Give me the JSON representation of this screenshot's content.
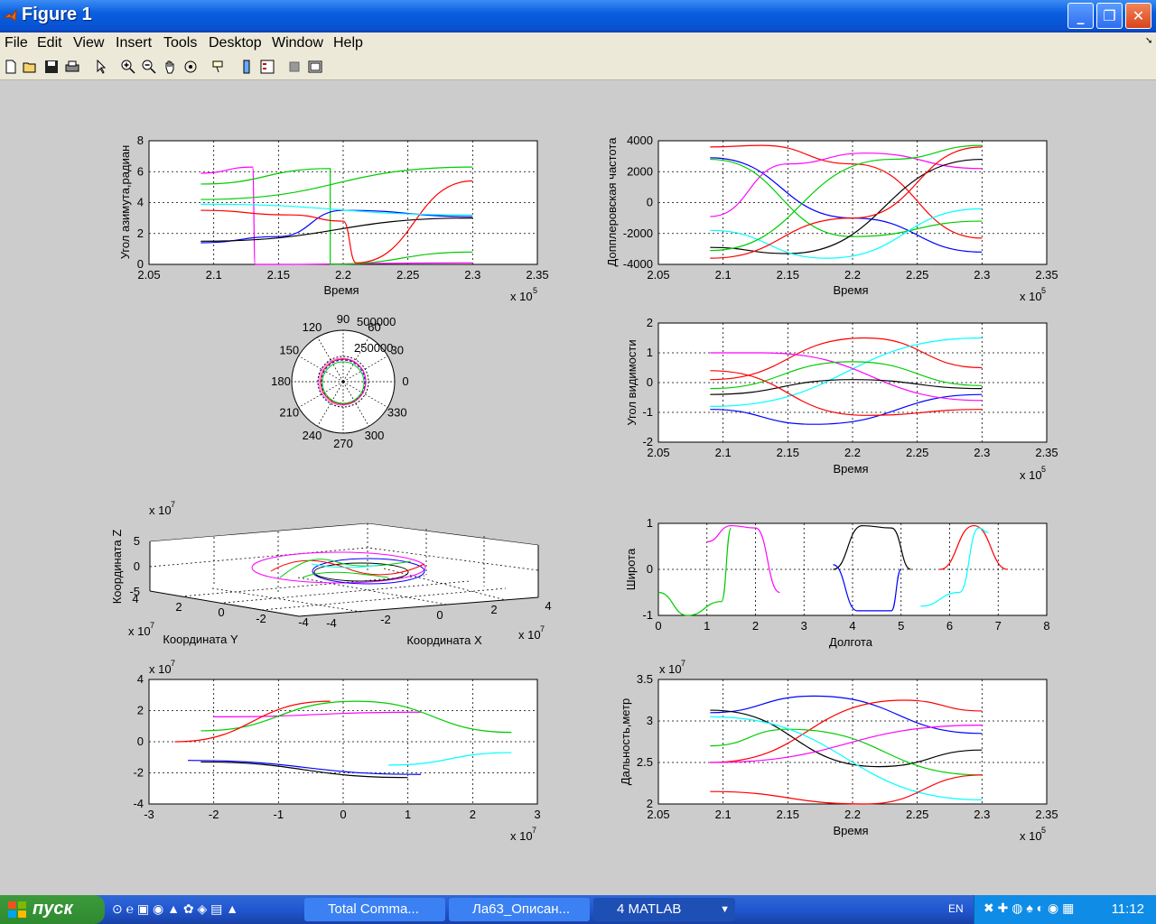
{
  "window": {
    "title": "Figure 1",
    "min": "_",
    "max": "❐",
    "close": "✕"
  },
  "menu": [
    "File",
    "Edit",
    "View",
    "Insert",
    "Tools",
    "Desktop",
    "Window",
    "Help"
  ],
  "toolbar_icons": [
    "new-icon",
    "open-icon",
    "save-icon",
    "print-icon",
    "pointer-icon",
    "zoom-in-icon",
    "zoom-out-icon",
    "pan-icon",
    "rotate-icon",
    "datacursor-icon",
    "colorbar-icon",
    "legend-icon",
    "hide-plot-tools-icon",
    "show-plot-tools-icon"
  ],
  "axes_texts": {
    "azimuth": {
      "ylabel": "Угол азимута,радиан",
      "xlabel": "Время",
      "xexp": "x 10",
      "xexp_p": "5",
      "xticks": [
        "2.05",
        "2.1",
        "2.15",
        "2.2",
        "2.25",
        "2.3",
        "2.35"
      ],
      "yticks": [
        "0",
        "2",
        "4",
        "6",
        "8"
      ]
    },
    "doppler": {
      "ylabel": "Допплеровская частота",
      "xlabel": "Время",
      "xexp": "x 10",
      "xexp_p": "5",
      "xticks": [
        "2.05",
        "2.1",
        "2.15",
        "2.2",
        "2.25",
        "2.3",
        "2.35"
      ],
      "yticks": [
        "-4000",
        "-2000",
        "0",
        "2000",
        "4000"
      ]
    },
    "polar": {
      "angles": [
        "90",
        "60",
        "30",
        "0",
        "330",
        "300",
        "270",
        "240",
        "210",
        "180",
        "150",
        "120"
      ],
      "radii": [
        "500000",
        "250000"
      ]
    },
    "elevation": {
      "ylabel": "Угол видимости",
      "xlabel": "Время",
      "xexp": "x 10",
      "xexp_p": "5",
      "xticks": [
        "2.05",
        "2.1",
        "2.15",
        "2.2",
        "2.25",
        "2.3",
        "2.35"
      ],
      "yticks": [
        "-2",
        "-1",
        "0",
        "1",
        "2"
      ]
    },
    "orbit3d": {
      "zlabel": "Координата Z",
      "ylabel": "Координата Y",
      "xlabel": "Координата X",
      "zexp": "x 10",
      "zexp_p": "7",
      "yexp": "x 10",
      "yexp_p": "7",
      "xexp": "x 10",
      "xexp_p": "7",
      "zticks": [
        "5",
        "0",
        "-5"
      ],
      "yticks": [
        "4",
        "2",
        "0",
        "-2",
        "-4"
      ],
      "xticks": [
        "-4",
        "-2",
        "0",
        "2",
        "4"
      ]
    },
    "latlon": {
      "ylabel": "Широта",
      "xlabel": "Долгота",
      "xticks": [
        "0",
        "1",
        "2",
        "3",
        "4",
        "5",
        "6",
        "7",
        "8"
      ],
      "yticks": [
        "-1",
        "0",
        "1"
      ]
    },
    "xy": {
      "yexp": "x 10",
      "yexp_p": "7",
      "xexp": "x 10",
      "xexp_p": "7",
      "xticks": [
        "-3",
        "-2",
        "-1",
        "0",
        "1",
        "2",
        "3"
      ],
      "yticks": [
        "-4",
        "-2",
        "0",
        "2",
        "4"
      ]
    },
    "range": {
      "ylabel": "Дальность,метр",
      "xlabel": "Время",
      "yexp": "x 10",
      "yexp_p": "7",
      "xexp": "x 10",
      "xexp_p": "5",
      "xticks": [
        "2.05",
        "2.1",
        "2.15",
        "2.2",
        "2.25",
        "2.3",
        "2.35"
      ],
      "yticks": [
        "2",
        "2.5",
        "3",
        "3.5"
      ]
    }
  },
  "chart_data": [
    {
      "type": "line",
      "title": "",
      "xlabel": "Время",
      "ylabel": "Угол азимута,радиан",
      "xlim": [
        205000,
        235000
      ],
      "ylim": [
        0,
        8
      ],
      "grid": true,
      "series": [
        {
          "color": "#ff00ff",
          "x": [
            209000,
            213000,
            213200,
            230000
          ],
          "y": [
            5.9,
            6.3,
            0,
            0.1
          ]
        },
        {
          "color": "#00cc00",
          "x": [
            209000,
            219000,
            219000,
            230000
          ],
          "y": [
            5.2,
            6.2,
            0,
            0.8
          ]
        },
        {
          "color": "#00cc00",
          "x": [
            209000,
            230000
          ],
          "y": [
            4.2,
            6.3
          ]
        },
        {
          "color": "#0000ff",
          "x": [
            209000,
            215000,
            220000,
            230000
          ],
          "y": [
            1.4,
            1.8,
            3.5,
            3.1
          ]
        },
        {
          "color": "#000000",
          "x": [
            209000,
            230000
          ],
          "y": [
            1.5,
            3.0
          ]
        },
        {
          "color": "#ff0000",
          "x": [
            209000,
            216000,
            220000,
            221000,
            230000
          ],
          "y": [
            3.5,
            3.2,
            2.8,
            0.1,
            5.4
          ]
        },
        {
          "color": "#00ffff",
          "x": [
            209000,
            230000
          ],
          "y": [
            3.9,
            3.2
          ]
        }
      ]
    },
    {
      "type": "line",
      "title": "",
      "xlabel": "Время",
      "ylabel": "Допплеровская частота",
      "xlim": [
        205000,
        235000
      ],
      "ylim": [
        -4000,
        4000
      ],
      "grid": true,
      "series": [
        {
          "color": "#ff0000",
          "x": [
            209000,
            213000,
            220000,
            230000
          ],
          "y": [
            3600,
            3700,
            2500,
            -2300
          ]
        },
        {
          "color": "#0000ff",
          "x": [
            209000,
            220000,
            230000
          ],
          "y": [
            2900,
            -1000,
            -3200
          ]
        },
        {
          "color": "#ff00ff",
          "x": [
            209000,
            215000,
            221000,
            230000
          ],
          "y": [
            -900,
            2500,
            3200,
            2200
          ]
        },
        {
          "color": "#00cc00",
          "x": [
            209000,
            220000,
            230000
          ],
          "y": [
            2800,
            -2200,
            -1200
          ]
        },
        {
          "color": "#000000",
          "x": [
            209000,
            215000,
            230000
          ],
          "y": [
            -2900,
            -3300,
            2800
          ]
        },
        {
          "color": "#00ffff",
          "x": [
            209000,
            218000,
            230000
          ],
          "y": [
            -1800,
            -3600,
            -400
          ]
        },
        {
          "color": "#ff0000",
          "x": [
            209000,
            220000,
            230000
          ],
          "y": [
            -3600,
            -1000,
            3600
          ]
        },
        {
          "color": "#00cc00",
          "x": [
            209000,
            223000,
            230000
          ],
          "y": [
            -3100,
            2800,
            3700
          ]
        }
      ]
    },
    {
      "type": "line",
      "title": "",
      "xlabel": "Время",
      "ylabel": "Угол видимости",
      "xlim": [
        205000,
        235000
      ],
      "ylim": [
        -2,
        2
      ],
      "grid": true,
      "series": [
        {
          "color": "#ff0000",
          "x": [
            209000,
            221000,
            230000
          ],
          "y": [
            0.1,
            1.5,
            0.5
          ]
        },
        {
          "color": "#0000ff",
          "x": [
            209000,
            217000,
            230000
          ],
          "y": [
            -0.9,
            -1.4,
            -0.4
          ]
        },
        {
          "color": "#00ffff",
          "x": [
            209000,
            230000
          ],
          "y": [
            -0.8,
            1.5
          ]
        },
        {
          "color": "#ff00ff",
          "x": [
            209000,
            213000,
            230000
          ],
          "y": [
            1.0,
            1.0,
            -0.6
          ]
        },
        {
          "color": "#00cc00",
          "x": [
            209000,
            220000,
            230000
          ],
          "y": [
            -0.2,
            0.7,
            -0.1
          ]
        },
        {
          "color": "#000000",
          "x": [
            209000,
            220000,
            230000
          ],
          "y": [
            -0.4,
            0.1,
            -0.2
          ]
        },
        {
          "color": "#ff0000",
          "x": [
            209000,
            221000,
            230000
          ],
          "y": [
            0.4,
            -1.1,
            -0.9
          ]
        }
      ]
    },
    {
      "type": "scatter",
      "title": "",
      "xlabel": "Долгота",
      "ylabel": "Широта",
      "xlim": [
        0,
        8
      ],
      "ylim": [
        -1,
        1
      ],
      "grid": true,
      "series": [
        {
          "color": "#00cc00",
          "x": [
            0,
            0.6,
            1.3,
            1.5
          ],
          "y": [
            -0.5,
            -1,
            -0.7,
            0.9
          ]
        },
        {
          "color": "#ff00ff",
          "x": [
            1.0,
            1.5,
            2.0,
            2.5
          ],
          "y": [
            0.6,
            0.95,
            0.9,
            -0.5
          ]
        },
        {
          "color": "#000000",
          "x": [
            3.6,
            4.2,
            4.8,
            5.2
          ],
          "y": [
            0,
            0.95,
            0.9,
            0
          ]
        },
        {
          "color": "#0000ff",
          "x": [
            3.6,
            4.1,
            4.8,
            5.0
          ],
          "y": [
            0.1,
            -0.9,
            -0.9,
            0
          ]
        },
        {
          "color": "#ff0000",
          "x": [
            5.8,
            6.5,
            7.2
          ],
          "y": [
            0,
            0.95,
            0
          ]
        },
        {
          "color": "#00ffff",
          "x": [
            5.4,
            6.2,
            6.6,
            6.8
          ],
          "y": [
            -0.8,
            -0.5,
            0.9,
            0.8
          ]
        }
      ]
    },
    {
      "type": "line",
      "title": "",
      "xlabel": "",
      "ylabel": "",
      "xlim": [
        -3,
        3
      ],
      "ylim": [
        -4,
        4
      ],
      "grid": true,
      "series": [
        {
          "color": "#ff00ff",
          "x": [
            -2.0,
            1.2
          ],
          "y": [
            1.6,
            1.9
          ]
        },
        {
          "color": "#00cc00",
          "x": [
            -2.2,
            0.2,
            2.6
          ],
          "y": [
            0.7,
            2.6,
            0.6
          ]
        },
        {
          "color": "#ff0000",
          "x": [
            -2.6,
            -0.2
          ],
          "y": [
            0,
            2.6
          ]
        },
        {
          "color": "#0000ff",
          "x": [
            -2.4,
            1.2
          ],
          "y": [
            -1.2,
            -2.1
          ]
        },
        {
          "color": "#000000",
          "x": [
            -2.2,
            1.0
          ],
          "y": [
            -1.3,
            -2.3
          ]
        },
        {
          "color": "#00ffff",
          "x": [
            0.7,
            2.6
          ],
          "y": [
            -1.5,
            -0.7
          ]
        }
      ]
    },
    {
      "type": "line",
      "title": "",
      "xlabel": "Время",
      "ylabel": "Дальность,метр",
      "xlim": [
        205000,
        235000
      ],
      "ylim": [
        2,
        3.5
      ],
      "grid": true,
      "series": [
        {
          "color": "#0000ff",
          "x": [
            209000,
            217000,
            230000
          ],
          "y": [
            3.1,
            3.3,
            2.85
          ]
        },
        {
          "color": "#000000",
          "x": [
            209000,
            222000,
            230000
          ],
          "y": [
            3.13,
            2.45,
            2.65
          ]
        },
        {
          "color": "#ff0000",
          "x": [
            209000,
            224000,
            230000
          ],
          "y": [
            2.5,
            3.25,
            3.12
          ]
        },
        {
          "color": "#00cc00",
          "x": [
            209000,
            215000,
            230000
          ],
          "y": [
            2.7,
            2.9,
            2.35
          ]
        },
        {
          "color": "#00ffff",
          "x": [
            209000,
            230000
          ],
          "y": [
            3.05,
            2.05
          ]
        },
        {
          "color": "#ff0000",
          "x": [
            209000,
            221000,
            230000
          ],
          "y": [
            2.15,
            2.0,
            2.35
          ]
        },
        {
          "color": "#ff00ff",
          "x": [
            209000,
            230000
          ],
          "y": [
            2.5,
            2.95
          ]
        }
      ]
    }
  ],
  "taskbar": {
    "start": "пуск",
    "tasks": [
      "Total Comma...",
      "Ла63_Описан...",
      "4 MATLAB"
    ],
    "lang": "EN",
    "clock": "11:12"
  }
}
